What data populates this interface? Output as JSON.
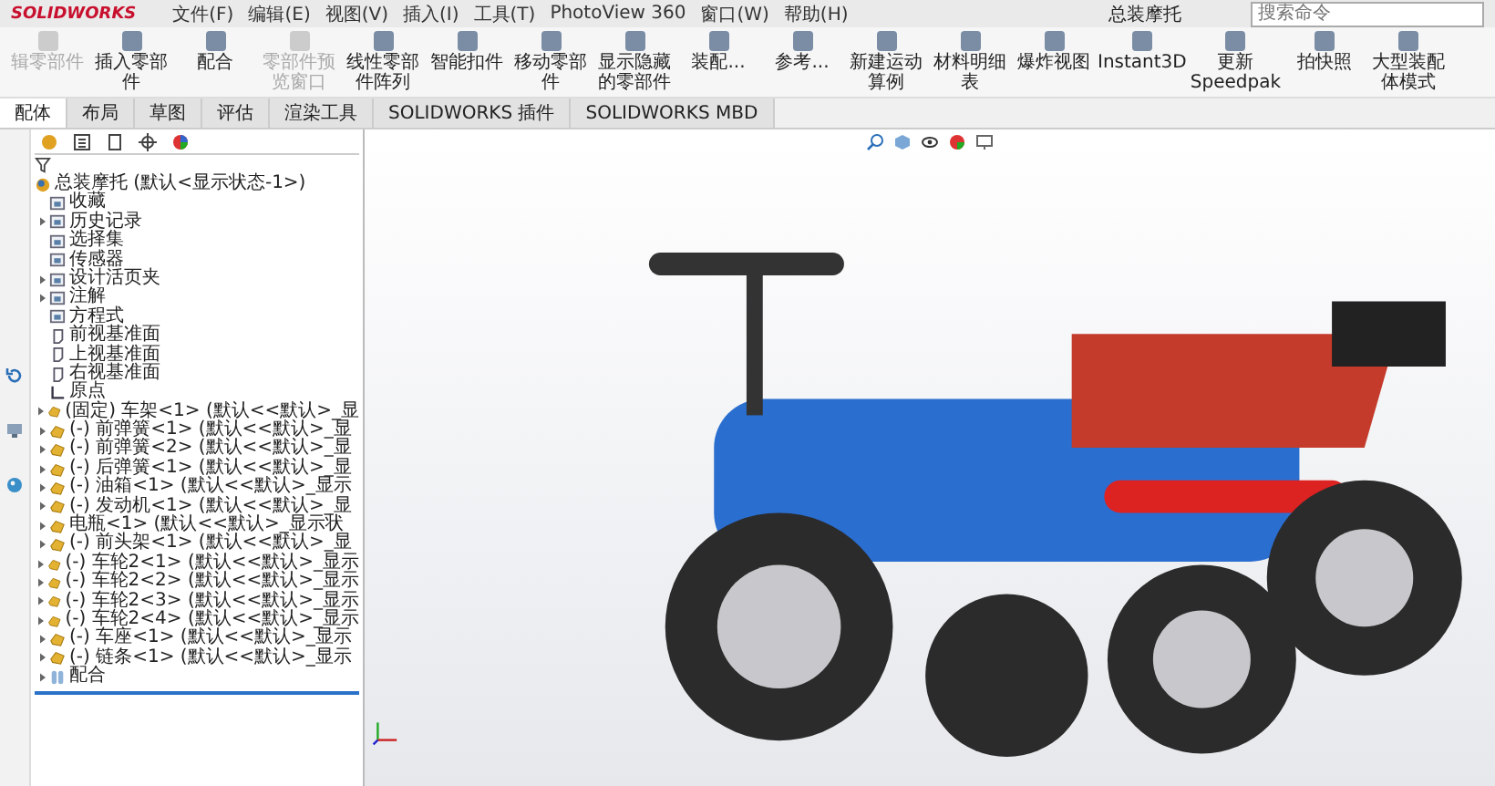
{
  "app": {
    "logo": "SOLIDWORKS",
    "menu": [
      "文件(F)",
      "编辑(E)",
      "视图(V)",
      "插入(I)",
      "工具(T)",
      "PhotoView 360",
      "窗口(W)",
      "帮助(H)"
    ],
    "title": "总装摩托",
    "search": {
      "placeholder": "搜索命令"
    }
  },
  "ribbon": [
    {
      "label": "辑零部件",
      "disabled": true
    },
    {
      "label": "插入零部件",
      "disabled": false
    },
    {
      "label": "配合",
      "disabled": false
    },
    {
      "label": "零部件预览窗口",
      "disabled": true
    },
    {
      "label": "线性零部件阵列",
      "disabled": false
    },
    {
      "label": "智能扣件",
      "disabled": false
    },
    {
      "label": "移动零部件",
      "disabled": false
    },
    {
      "label": "显示隐藏的零部件",
      "disabled": false
    },
    {
      "label": "装配...",
      "disabled": false
    },
    {
      "label": "参考...",
      "disabled": false
    },
    {
      "label": "新建运动算例",
      "disabled": false
    },
    {
      "label": "材料明细表",
      "disabled": false
    },
    {
      "label": "爆炸视图",
      "disabled": false
    },
    {
      "label": "Instant3D",
      "disabled": false
    },
    {
      "label": "更新Speedpak",
      "disabled": false
    },
    {
      "label": "拍快照",
      "disabled": false
    },
    {
      "label": "大型装配体模式",
      "disabled": false
    }
  ],
  "tabs": [
    {
      "label": "配体",
      "selected": true
    },
    {
      "label": "布局",
      "selected": false
    },
    {
      "label": "草图",
      "selected": false
    },
    {
      "label": "评估",
      "selected": false
    },
    {
      "label": "渲染工具",
      "selected": false
    },
    {
      "label": "SOLIDWORKS 插件",
      "selected": false
    },
    {
      "label": "SOLIDWORKS MBD",
      "selected": false
    }
  ],
  "tree": {
    "root": "总装摩托 (默认<显示状态-1>)",
    "items": [
      {
        "label": "收藏",
        "kind": "folder",
        "expandable": false
      },
      {
        "label": "历史记录",
        "kind": "folder",
        "expandable": true
      },
      {
        "label": "选择集",
        "kind": "folder",
        "expandable": false
      },
      {
        "label": "传感器",
        "kind": "folder",
        "expandable": false
      },
      {
        "label": "设计活页夹",
        "kind": "folder",
        "expandable": true
      },
      {
        "label": "注解",
        "kind": "folder",
        "expandable": true
      },
      {
        "label": "方程式",
        "kind": "folder",
        "expandable": false
      },
      {
        "label": "前视基准面",
        "kind": "plane",
        "expandable": false
      },
      {
        "label": "上视基准面",
        "kind": "plane",
        "expandable": false
      },
      {
        "label": "右视基准面",
        "kind": "plane",
        "expandable": false
      },
      {
        "label": "原点",
        "kind": "origin",
        "expandable": false
      },
      {
        "label": "(固定) 车架<1> (默认<<默认>_显",
        "kind": "part",
        "expandable": true
      },
      {
        "label": "(-) 前弹簧<1> (默认<<默认>_显",
        "kind": "part",
        "expandable": true
      },
      {
        "label": "(-) 前弹簧<2> (默认<<默认>_显",
        "kind": "part",
        "expandable": true
      },
      {
        "label": "(-) 后弹簧<1> (默认<<默认>_显",
        "kind": "part",
        "expandable": true
      },
      {
        "label": "(-) 油箱<1> (默认<<默认>_显示",
        "kind": "part",
        "expandable": true
      },
      {
        "label": "(-) 发动机<1> (默认<<默认>_显",
        "kind": "part",
        "expandable": true
      },
      {
        "label": "电瓶<1> (默认<<默认>_显示状",
        "kind": "part",
        "expandable": true
      },
      {
        "label": "(-) 前头架<1> (默认<<默认>_显",
        "kind": "part",
        "expandable": true
      },
      {
        "label": "(-) 车轮2<1> (默认<<默认>_显示",
        "kind": "part",
        "expandable": true
      },
      {
        "label": "(-) 车轮2<2> (默认<<默认>_显示",
        "kind": "part",
        "expandable": true
      },
      {
        "label": "(-) 车轮2<3> (默认<<默认>_显示",
        "kind": "part",
        "expandable": true
      },
      {
        "label": "(-) 车轮2<4> (默认<<默认>_显示",
        "kind": "part",
        "expandable": true
      },
      {
        "label": "(-) 车座<1> (默认<<默认>_显示",
        "kind": "part",
        "expandable": true
      },
      {
        "label": "(-) 链条<1> (默认<<默认>_显示",
        "kind": "part",
        "expandable": true
      },
      {
        "label": "配合",
        "kind": "mates",
        "expandable": true
      }
    ]
  }
}
